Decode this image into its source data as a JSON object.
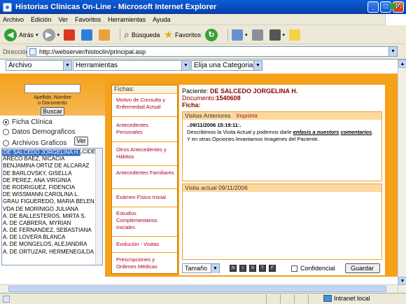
{
  "window": {
    "title": "Historias Clínicas On-Line - Microsoft Internet Explorer"
  },
  "menubar": {
    "items": [
      "Archivo",
      "Edición",
      "Ver",
      "Favoritos",
      "Herramientas",
      "Ayuda"
    ]
  },
  "toolbar": {
    "back": "Atrás",
    "search": "Búsqueda",
    "favorites": "Favoritos"
  },
  "address": {
    "label": "Dirección",
    "url": "http://webserver/histoclin/principal.asp",
    "go": "Ir"
  },
  "app_menu": {
    "archivo": "Archivo",
    "herramientas": "Herramientas",
    "categoria": "Elija una Categoria"
  },
  "search": {
    "hint": "Apellido, Nombre o Documento",
    "hint_line1": "Apellido, Nombre",
    "hint_line2": "o Documento",
    "button": "Buscar"
  },
  "radios": {
    "ficha": "Ficha Clínica",
    "demo": "Datos Demograficos",
    "arch": "Archivos Graficos",
    "ver": "Ver"
  },
  "patients": [
    "ARCE CHAPARRO, PEDRO ALCIDES",
    "ARECO BAEZ, NICACIA",
    "BENJAMINA ORTIZ DE ALCARAZ",
    "DE BARLOVSKY, GISELLA",
    "DE PEREZ, ANA VIRGINIA",
    "DE RODRIGUEZ, FIDENCIA",
    "DE SALCEDO JORGELINA H.",
    "DE WISSMANN CAROLINA L.",
    "GRAU FIGUEREDO, MARIA BELEN",
    "VDA DE MORINIGO JULIANA",
    "A. DE BALLESTEROS, MIRTA S.",
    "A. DE CABRERA, MYRIAN",
    "A. DE FERNANDEZ, SEBASTIANA",
    "A. DE LOVERA BLANCA",
    "A. DE MONGELOS, ALEJANDRA",
    "A. DE ORTUZAR, HERMENEGILDA"
  ],
  "fichas": {
    "title": "Fichas:",
    "items": [
      "Motivo de Consulta y Enfermedad Actual",
      "Antecedentes Personales",
      "Otros Antecedentes y Hábitos",
      "Antecedentes Familiares",
      "Exámen Físico Inicial",
      "Estudios Complementarios Iniciales",
      "Evolución - Visitas",
      "Prescripciones y Ordenes Médicas"
    ]
  },
  "patient": {
    "label": "Paciente:",
    "name": "DE SALCEDO JORGELINA H.",
    "doc_label": "Documento:",
    "doc": "1540608",
    "ficha_label": "Ficha:"
  },
  "visits": {
    "prev_label": "Visitas Anteriores",
    "print_label": "Imprimir",
    "entry_date": "..09/11/2006 15:19:11:.",
    "entry_text_a": "Describimos la Visita Actual y podemos darle",
    "entry_emph_1": "enfasis a nuestors",
    "entry_emph_2": "comentarios",
    "entry_text_b": ". Y en otras Opciones levantamos Imagenes del Paciente.",
    "current_label": "Visita actual 09/11/2006"
  },
  "editor": {
    "size": "Tamaño",
    "fmt": [
      "N",
      "I",
      "S",
      "T",
      "F"
    ],
    "confidential": "Confidencial",
    "save": "Guardar"
  },
  "status": {
    "zone": "Intranet local"
  },
  "colors": {
    "accent": "#f6a11a",
    "link": "#b00020",
    "selection": "#316ac5"
  }
}
